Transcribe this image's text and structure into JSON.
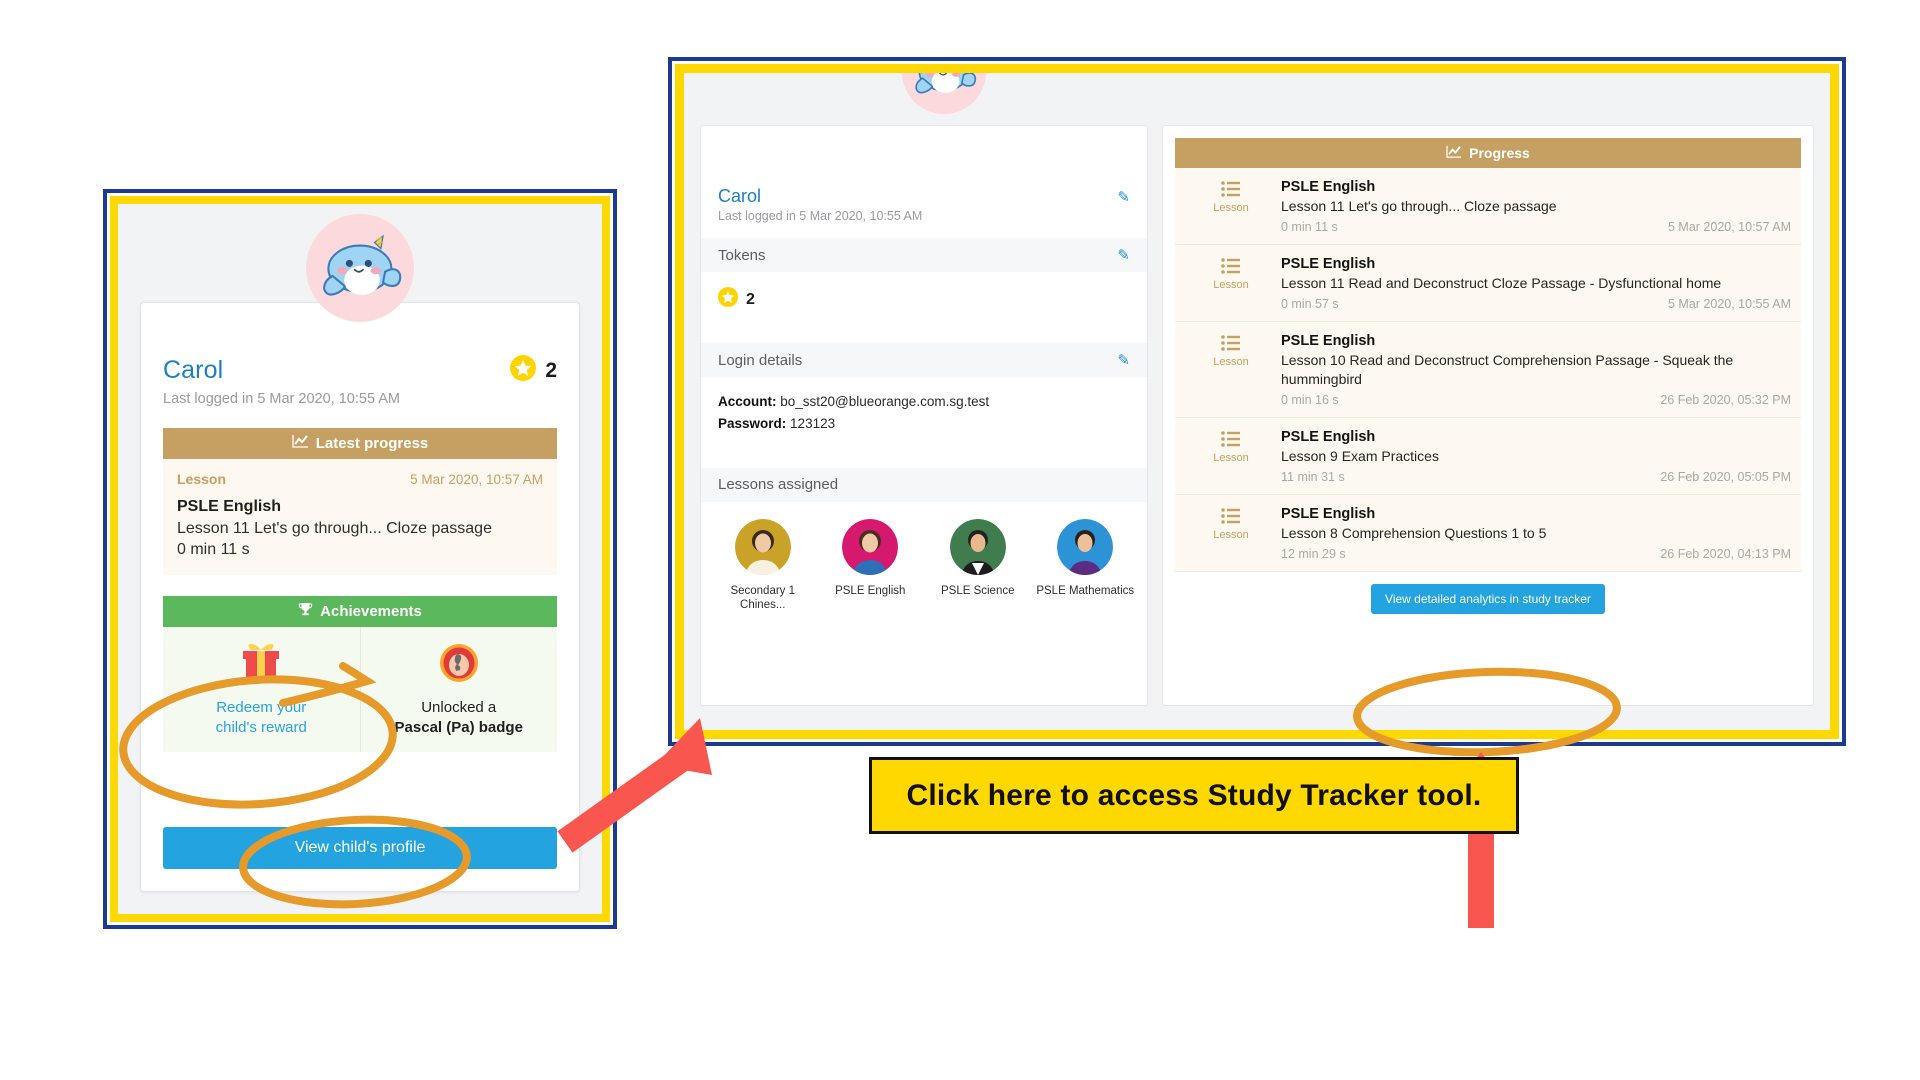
{
  "left_panel": {
    "avatar_icon": "narwhal-avatar",
    "name": "Carol",
    "last_login": "Last logged in 5 Mar 2020, 10:55 AM",
    "token_icon": "star-token-icon",
    "token_count": "2",
    "latest_progress": {
      "header_icon": "progress-chart-icon",
      "header": "Latest progress",
      "lesson_tag": "Lesson",
      "date": "5 Mar 2020, 10:57 AM",
      "subject": "PSLE English",
      "description": "Lesson 11 Let's go through... Cloze passage",
      "duration": "0 min 11 s"
    },
    "achievements": {
      "header_icon": "trophy-icon",
      "header": "Achievements",
      "items": [
        {
          "icon": "gift-icon",
          "label_line1": "Redeem your",
          "label_line2": "child's reward",
          "style": "link"
        },
        {
          "icon": "badge-medal-icon",
          "label_line1": "Unlocked a",
          "label_line2": "Pascal (Pa) badge",
          "style": "plain"
        }
      ]
    },
    "view_profile_button": "View child's profile"
  },
  "right_panel": {
    "avatar_icon": "narwhal-avatar",
    "name": "Carol",
    "last_login": "Last logged in 5 Mar 2020, 10:55 AM",
    "edit_icon": "pencil-edit-icon",
    "tokens_section": "Tokens",
    "token_icon": "star-token-icon",
    "token_count": "2",
    "login_section": "Login details",
    "account_label": "Account:",
    "account_value": "bo_sst20@blueorange.com.sg.test",
    "password_label": "Password:",
    "password_value": "123123",
    "lessons_section": "Lessons assigned",
    "lessons": [
      {
        "avatar": "teacher-avatar-gold",
        "label": "Secondary 1 Chines...",
        "bg": "#c9a227"
      },
      {
        "avatar": "teacher-avatar-pink",
        "label": "PSLE English",
        "bg": "#d6186e"
      },
      {
        "avatar": "teacher-avatar-green",
        "label": "PSLE Science",
        "bg": "#3f7d4f"
      },
      {
        "avatar": "teacher-avatar-blue",
        "label": "PSLE Mathematics",
        "bg": "#2b93d6"
      }
    ],
    "progress": {
      "header_icon": "progress-chart-icon",
      "header": "Progress",
      "row_icon": "lesson-list-icon",
      "row_icon_label": "Lesson",
      "rows": [
        {
          "subject": "PSLE English",
          "description": "Lesson 11 Let's go through... Cloze passage",
          "duration": "0 min 11 s",
          "date": "5 Mar 2020, 10:57 AM"
        },
        {
          "subject": "PSLE English",
          "description": "Lesson 11 Read and Deconstruct Cloze Passage - Dysfunctional home",
          "duration": "0 min 57 s",
          "date": "5 Mar 2020, 10:55 AM"
        },
        {
          "subject": "PSLE English",
          "description": "Lesson 10 Read and Deconstruct Comprehension Passage - Squeak the hummingbird",
          "duration": "0 min 16 s",
          "date": "26 Feb 2020, 05:32 PM"
        },
        {
          "subject": "PSLE English",
          "description": "Lesson 9 Exam Practices",
          "duration": "11 min 31 s",
          "date": "26 Feb 2020, 05:05 PM"
        },
        {
          "subject": "PSLE English",
          "description": "Lesson 8 Comprehension Questions 1 to 5",
          "duration": "12 min 29 s",
          "date": "26 Feb 2020, 04:13 PM"
        }
      ],
      "analytics_button": "View detailed analytics in study tracker"
    }
  },
  "annotations": {
    "callout_text": "Click here to access Study Tracker tool.",
    "ellipse_color": "#e59a2a",
    "arrow_color": "#f9564f",
    "frame_border_navy": "#1c3a8f",
    "frame_border_yellow": "#ffd800"
  }
}
